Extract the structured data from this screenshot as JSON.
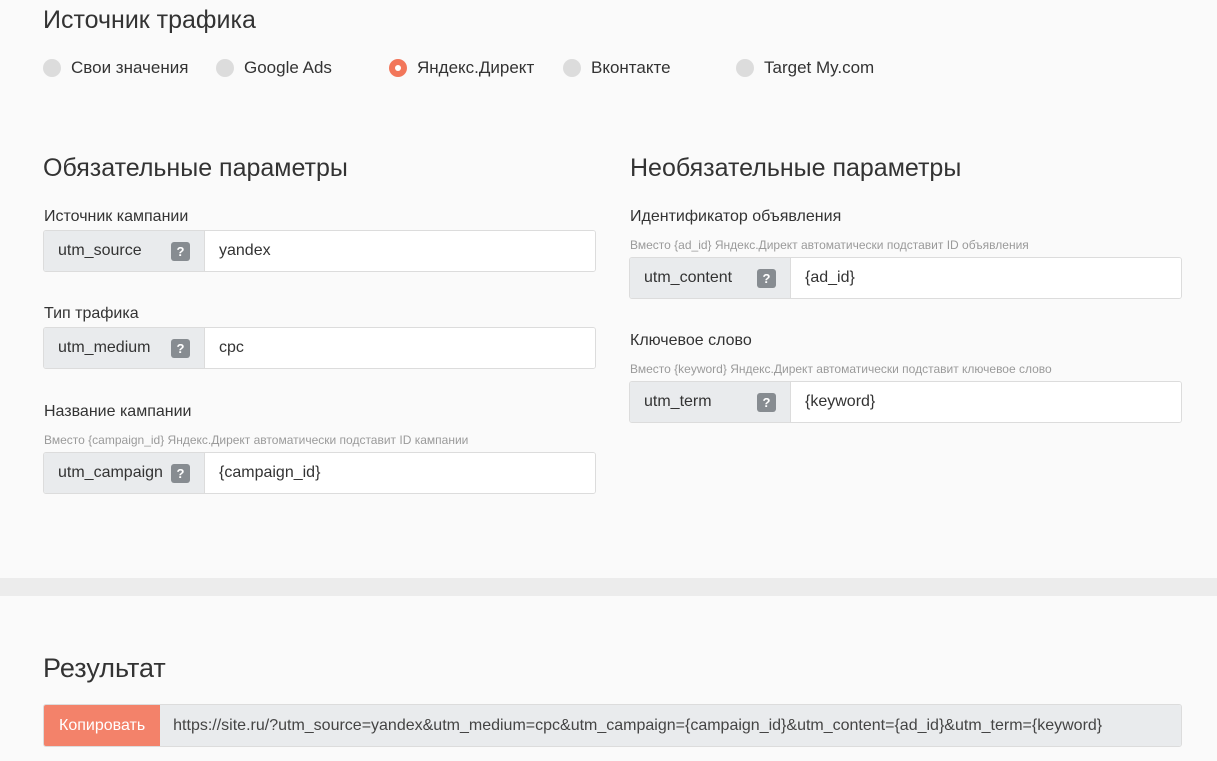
{
  "traffic_source": {
    "title": "Источник трафика",
    "options": [
      {
        "label": "Свои значения",
        "checked": false
      },
      {
        "label": "Google Ads",
        "checked": false
      },
      {
        "label": "Яндекс.Директ",
        "checked": true
      },
      {
        "label": "Вконтакте",
        "checked": false
      },
      {
        "label": "Target My.com",
        "checked": false
      }
    ]
  },
  "required": {
    "title": "Обязательные параметры",
    "fields": [
      {
        "label": "Источник кампании",
        "hint": "",
        "key": "utm_source",
        "value": "yandex"
      },
      {
        "label": "Тип трафика",
        "hint": "",
        "key": "utm_medium",
        "value": "cpc"
      },
      {
        "label": "Название кампании",
        "hint": "Вместо {campaign_id} Яндекс.Директ автоматически подставит ID кампании",
        "key": "utm_campaign",
        "value": "{campaign_id}"
      }
    ]
  },
  "optional": {
    "title": "Необязательные параметры",
    "fields": [
      {
        "label": "Идентификатор объявления",
        "hint": "Вместо {ad_id} Яндекс.Директ автоматически подставит ID объявления",
        "key": "utm_content",
        "value": "{ad_id}"
      },
      {
        "label": "Ключевое слово",
        "hint": "Вместо {keyword} Яндекс.Директ автоматически подставит ключевое слово",
        "key": "utm_term",
        "value": "{keyword}"
      }
    ]
  },
  "help_symbol": "?",
  "result": {
    "title": "Результат",
    "copy_label": "Копировать",
    "url": "https://site.ru/?utm_source=yandex&utm_medium=cpc&utm_campaign={campaign_id}&utm_content={ad_id}&utm_term={keyword}"
  },
  "colors": {
    "accent": "#f2765a",
    "copy_button": "#f3826a",
    "key_background": "#e9ebed",
    "help_badge": "#878c91"
  }
}
